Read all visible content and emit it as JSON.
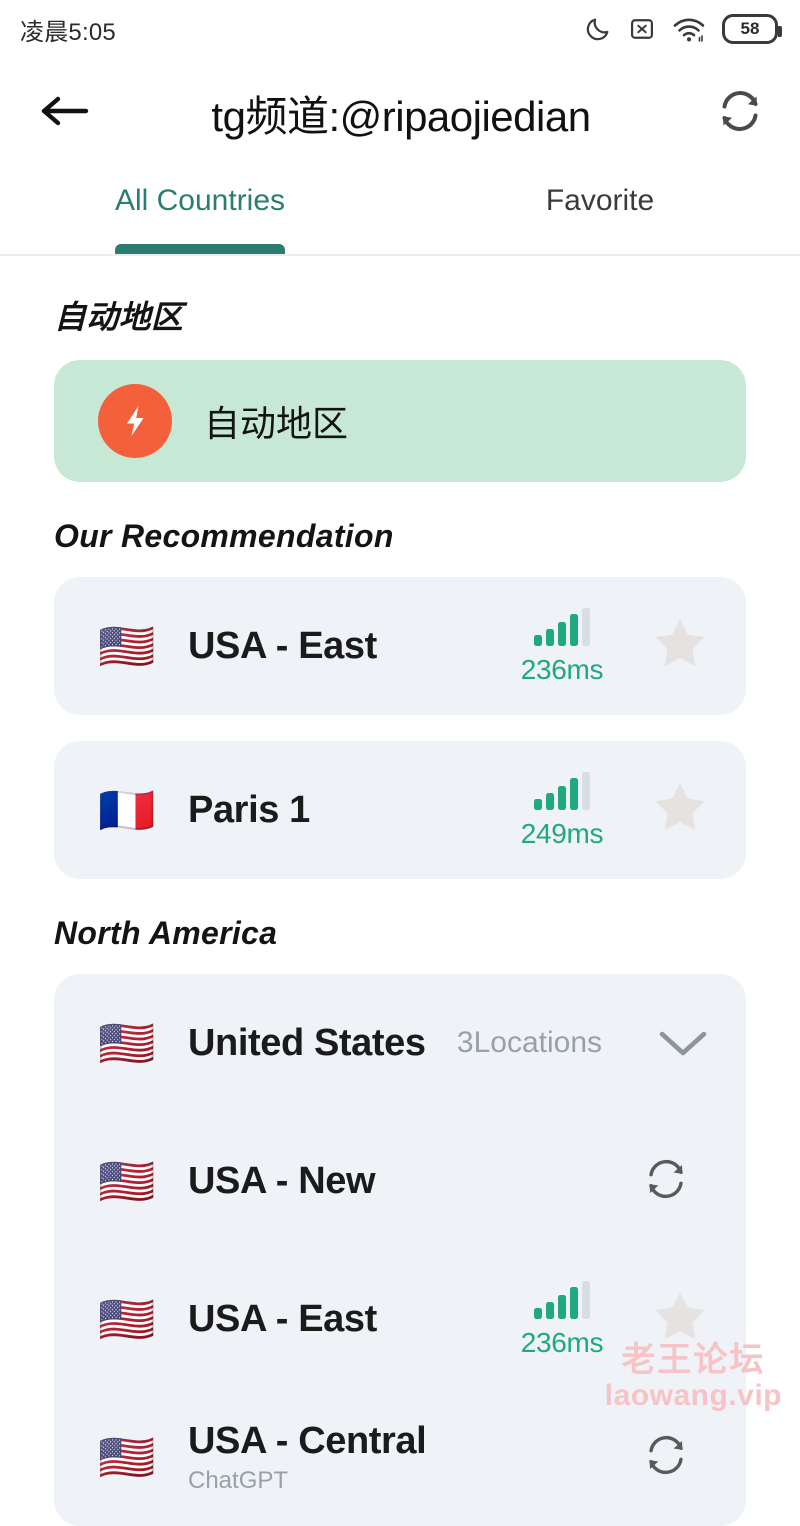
{
  "statusbar": {
    "time": "凌晨5:05",
    "battery_level": "58",
    "icons": [
      "moon-icon",
      "x-box-icon",
      "wifi-icon",
      "battery-icon"
    ]
  },
  "header": {
    "back_icon": "arrow-left-icon",
    "title": "tg频道:@ripaojiedian",
    "refresh_icon": "refresh-icon"
  },
  "tabs": [
    {
      "label": "All Countries",
      "active": true
    },
    {
      "label": "Favorite",
      "active": false
    }
  ],
  "colors": {
    "accent_teal": "#2c7d6f",
    "ping_green": "#1fa97c",
    "auto_card_bg": "#c6e8d5",
    "bolt_orange": "#f4603c",
    "row_card_bg": "#eff2f7",
    "muted_gray": "#9aa0a8",
    "watermark_pink": "#f6c4c6"
  },
  "sections": [
    {
      "title": "自动地区",
      "type": "auto",
      "items": [
        {
          "label": "自动地区",
          "icon": "bolt-icon"
        }
      ]
    },
    {
      "title": "Our Recommendation",
      "type": "list",
      "items": [
        {
          "flag": "🇺🇸",
          "label": "USA - East",
          "ping": "236ms",
          "bars": 4,
          "total_bars": 5,
          "trailing": "star"
        },
        {
          "flag": "🇫🇷",
          "label": "Paris 1",
          "ping": "249ms",
          "bars": 4,
          "total_bars": 5,
          "trailing": "star"
        }
      ]
    },
    {
      "title": "North America",
      "type": "list",
      "items": [
        {
          "flag": "🇺🇸",
          "label": "United States",
          "locations": "3Locations",
          "trailing": "chevron"
        },
        {
          "flag": "🇺🇸",
          "label": "USA - New",
          "trailing": "loading"
        },
        {
          "flag": "🇺🇸",
          "label": "USA - East",
          "ping": "236ms",
          "bars": 4,
          "total_bars": 5,
          "trailing": "star"
        },
        {
          "flag": "🇺🇸",
          "label": "USA - Central",
          "sublabel": "ChatGPT",
          "trailing": "loading"
        }
      ]
    }
  ],
  "watermark": {
    "line1": "老王论坛",
    "line2": "laowang.vip"
  }
}
